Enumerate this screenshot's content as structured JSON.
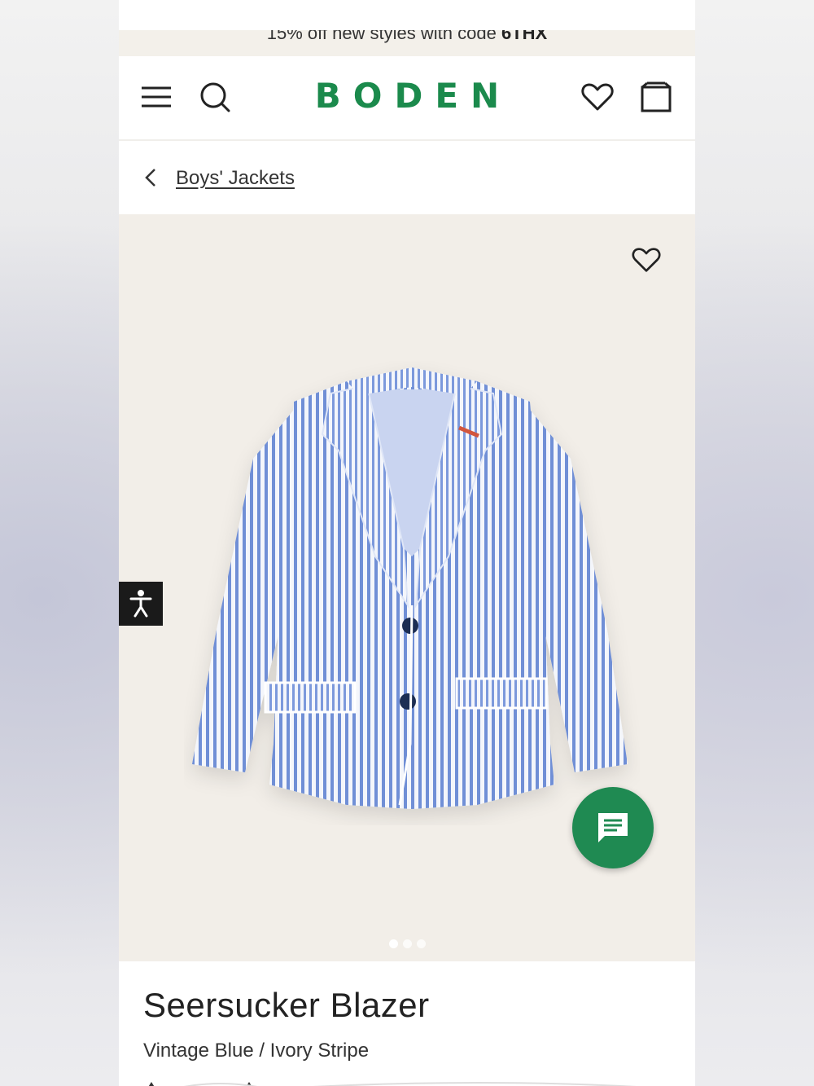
{
  "promo": {
    "text": "15% off new styles with code ",
    "code": "6THX"
  },
  "header": {
    "logo": "BODEN",
    "icons": [
      "menu-icon",
      "search-icon",
      "heart-icon",
      "bag-icon"
    ]
  },
  "breadcrumb": {
    "label": "Boys' Jackets"
  },
  "gallery": {
    "image_count": 3,
    "active_index": 0
  },
  "product": {
    "title": "Seersucker Blazer",
    "colour": "Vintage Blue / Ivory Stripe"
  },
  "colors": {
    "brand": "#1b8a4c",
    "chat": "#1f8a52",
    "gallery_bg": "#f2eee8",
    "promo_bg": "#f3f0ea"
  }
}
